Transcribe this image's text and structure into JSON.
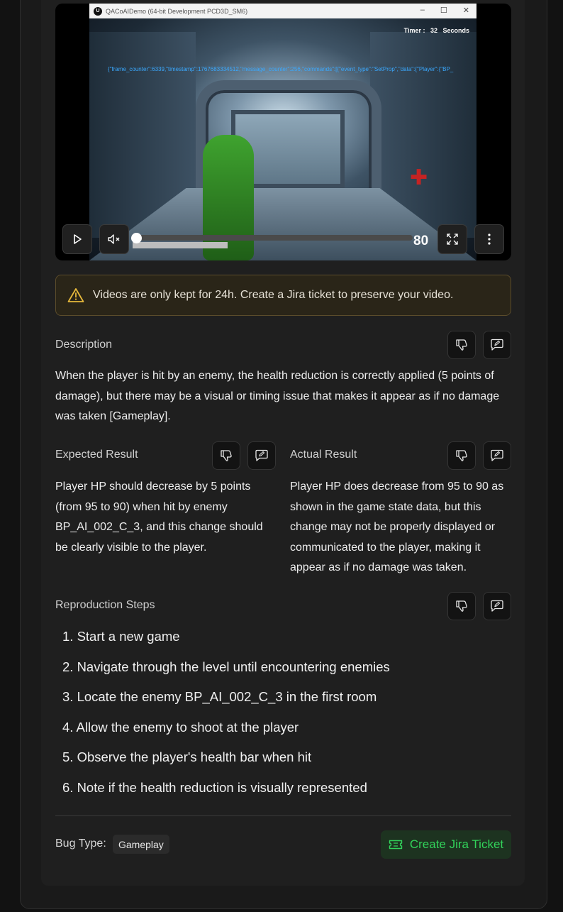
{
  "video": {
    "window_title": "QACoAIDemo (64-bit Development PCD3D_SM6)",
    "ue_logo": "U",
    "timer_text": "Timer :   32   Seconds",
    "debug_text": "{\"frame_counter\":6339,\"timestamp\":1767683334512,\"message_counter\":256,\"commands\":[{\"event_type\":\"SetProp\",\"data\":{\"Player\":{\"BP_",
    "overlay_number": "80",
    "progress": 0.0,
    "buffered": 0.34,
    "controls": {
      "play_icon": "play-icon",
      "mute_icon": "volume-muted-icon",
      "fullscreen_icon": "fullscreen-icon",
      "more_icon": "more-vertical-icon"
    }
  },
  "warning": {
    "text": "Videos are only kept for 24h. Create a Jira ticket to preserve your video."
  },
  "description": {
    "label": "Description",
    "text": "When the player is hit by an enemy, the health reduction is correctly applied (5 points of damage), but there may be a visual or timing issue that makes it appear as if no damage was taken [Gameplay]."
  },
  "expected": {
    "label": "Expected Result",
    "text": "Player HP should decrease by 5 points (from 95 to 90) when hit by enemy BP_AI_002_C_3, and this change should be clearly visible to the player."
  },
  "actual": {
    "label": "Actual Result",
    "text": "Player HP does decrease from 95 to 90 as shown in the game state data, but this change may not be properly displayed or communicated to the player, making it appear as if no damage was taken."
  },
  "steps": {
    "label": "Reproduction Steps",
    "items": [
      "1. Start a new game",
      "2. Navigate through the level until encountering enemies",
      "3. Locate the enemy BP_AI_002_C_3 in the first room",
      "4. Allow the enemy to shoot at the player",
      "5. Observe the player's health bar when hit",
      "6. Note if the health reduction is visually represented"
    ]
  },
  "footer": {
    "bug_type_label": "Bug Type:",
    "bug_type_value": "Gameplay",
    "jira_button": "Create Jira Ticket"
  },
  "colors": {
    "accent_green": "#32d35a",
    "warning_yellow": "#e6b83b"
  }
}
